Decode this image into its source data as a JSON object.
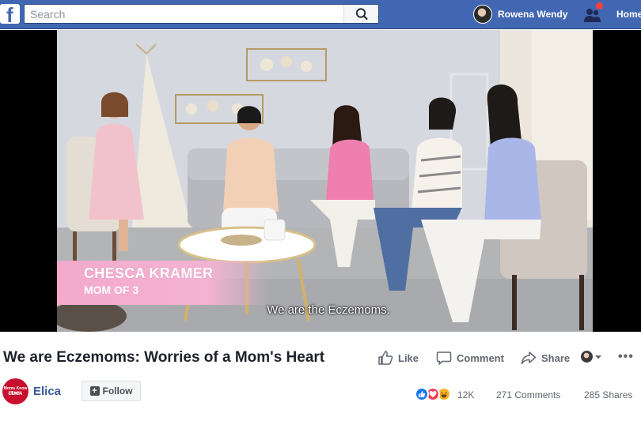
{
  "header": {
    "search": {
      "placeholder": "Search"
    },
    "user": {
      "name": "Rowena Wendy"
    },
    "home_label": "Home",
    "brand_color": "#4267b2",
    "notification_color": "#fa3e3e"
  },
  "video": {
    "lower_third": {
      "name": "CHESCA KRAMER",
      "subtitle": "MOM OF 3"
    },
    "caption": "We are the Eczemoms."
  },
  "post": {
    "title": "We are Eczemoms: Worries of a Mom's Heart",
    "actions": {
      "like": "Like",
      "comment": "Comment",
      "share": "Share"
    },
    "page": {
      "name": "Elica",
      "logo_text_top": "Moms Know Best",
      "logo_text_bottom": "ELICA"
    },
    "follow_label": "Follow",
    "stats": {
      "reactions": "12K",
      "comments": "271 Comments",
      "shares": "285 Shares"
    },
    "reaction_icons": [
      "like-reaction-icon",
      "love-reaction-icon",
      "haha-reaction-icon"
    ]
  }
}
